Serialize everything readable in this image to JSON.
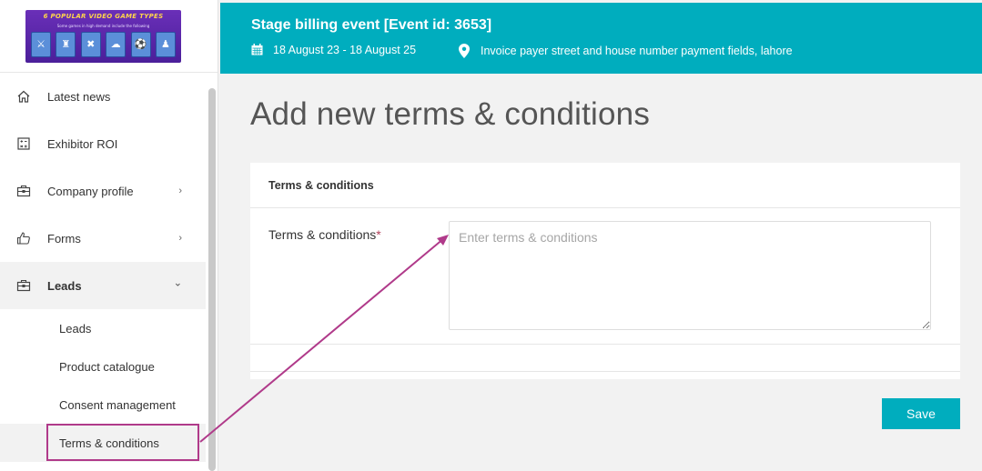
{
  "logo": {
    "title": "6 POPULAR VIDEO GAME TYPES",
    "subtitle": "Some games in high demand include the following",
    "tiles": [
      "⚔",
      "♜",
      "✖",
      "☁",
      "⚽",
      "♟"
    ]
  },
  "sidebar": {
    "items": [
      {
        "label": "Latest news",
        "icon": "home-icon"
      },
      {
        "label": "Exhibitor ROI",
        "icon": "calculator-icon"
      },
      {
        "label": "Company profile",
        "icon": "briefcase-icon",
        "chevron": "›"
      },
      {
        "label": "Forms",
        "icon": "thumbs-up-icon",
        "chevron": "›"
      },
      {
        "label": "Leads",
        "icon": "briefcase-icon",
        "chevron": "⌄"
      }
    ],
    "subitems": [
      {
        "label": "Leads"
      },
      {
        "label": "Product catalogue"
      },
      {
        "label": "Consent management"
      },
      {
        "label": "Terms & conditions"
      }
    ]
  },
  "header": {
    "title": "Stage billing event [Event id: 3653]",
    "dates": "18 August 23 - 18 August 25",
    "location": "Invoice payer street and house number payment fields, lahore"
  },
  "main": {
    "page_title": "Add new terms & conditions",
    "section_title": "Terms & conditions",
    "field_label": "Terms & conditions",
    "required_mark": "*",
    "field_placeholder": "Enter terms & conditions",
    "save_label": "Save"
  },
  "colors": {
    "accent": "#00adbe",
    "annotation": "#b03a8a"
  }
}
